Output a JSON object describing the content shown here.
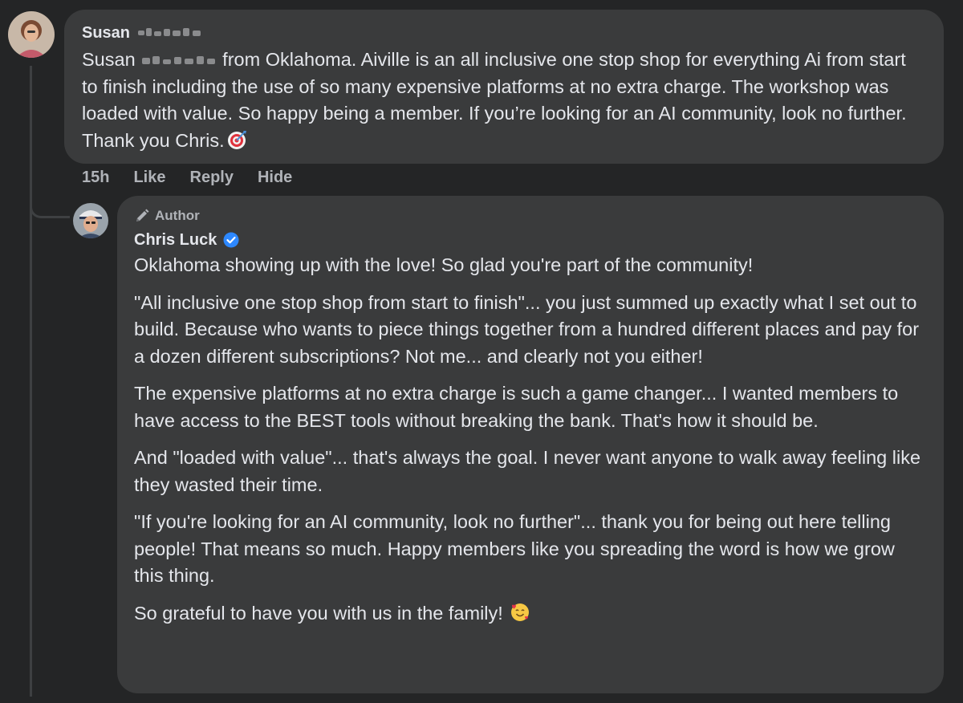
{
  "parent_comment": {
    "author_first_name": "Susan",
    "text_prefix": "Susan",
    "text_body": " from Oklahoma. Aiville is an all inclusive one stop shop for everything Ai from start to finish including the use of so many expensive platforms at no extra charge. The workshop was loaded with value. So happy being a member. If you’re looking for an AI community, look no further. Thank you Chris.",
    "emoji_icon": "direct-hit-target-icon",
    "timestamp": "15h",
    "actions": {
      "like": "Like",
      "reply": "Reply",
      "hide": "Hide"
    }
  },
  "reply_comment": {
    "badge_label": "Author",
    "badge_icon": "pencil-icon",
    "author_name": "Chris Luck",
    "verified_icon": "verified-badge-icon",
    "paragraphs": [
      "Oklahoma showing up with the love! So glad you're part of the community!",
      "\"All inclusive one stop shop from start to finish\"... you just summed up exactly what I set out to build. Because who wants to piece things together from a hundred different places and pay for a dozen different subscriptions? Not me... and clearly not you either!",
      "The expensive platforms at no extra charge is such a game changer... I wanted members to have access to the BEST tools without breaking the bank. That's how it should be.",
      "And \"loaded with value\"... that's always the goal. I never want anyone to walk away feeling like they wasted their time.",
      "\"If you're looking for an AI community, look no further\"... thank you for being out here telling people! That means so much. Happy members like you spreading the word is how we grow this thing.",
      "So grateful to have you with us in the family!"
    ],
    "closing_emoji_icon": "smiling-face-with-hearts-icon"
  },
  "colors": {
    "background": "#242526",
    "bubble": "#3a3b3c",
    "primary_text": "#e4e6eb",
    "secondary_text": "#b0b3b8",
    "verified_blue": "#2d88ff",
    "thread_line": "#3e4042"
  }
}
